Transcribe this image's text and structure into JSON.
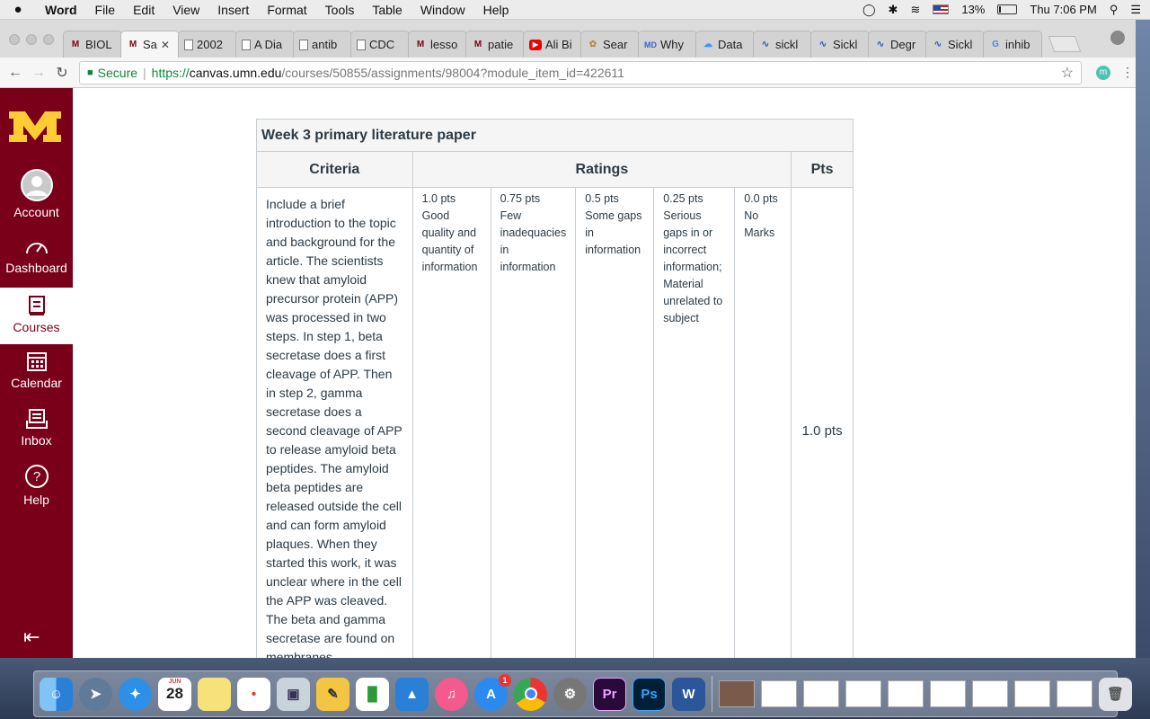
{
  "menubar": {
    "apple": "",
    "app_name": "Word",
    "items": [
      "File",
      "Edit",
      "View",
      "Insert",
      "Format",
      "Tools",
      "Table",
      "Window",
      "Help"
    ],
    "battery_percent": "13%",
    "battery_level": 0.13,
    "clock": "Thu 7:06 PM"
  },
  "tabs": [
    {
      "label": "BIOL",
      "icon": "umn-m-icon"
    },
    {
      "label": "Sa",
      "icon": "umn-m-icon",
      "active": true
    },
    {
      "label": "2002",
      "icon": "document-icon"
    },
    {
      "label": "A Dia",
      "icon": "document-icon"
    },
    {
      "label": "antib",
      "icon": "document-icon"
    },
    {
      "label": "CDC",
      "icon": "document-icon"
    },
    {
      "label": "lesso",
      "icon": "umn-m-icon"
    },
    {
      "label": "patie",
      "icon": "umn-m-icon"
    },
    {
      "label": "Ali Bi",
      "icon": "youtube-icon"
    },
    {
      "label": "Sear",
      "icon": "ali-icon"
    },
    {
      "label": "Why",
      "icon": "webmd-icon"
    },
    {
      "label": "Data",
      "icon": "cloud-icon"
    },
    {
      "label": "sickl",
      "icon": "dna-icon"
    },
    {
      "label": "Sickl",
      "icon": "dna-icon"
    },
    {
      "label": "Degr",
      "icon": "dna-icon"
    },
    {
      "label": "Sickl",
      "icon": "dna-icon"
    },
    {
      "label": "inhib",
      "icon": "google-icon"
    }
  ],
  "address_bar": {
    "secure_label": "Secure",
    "url_scheme": "https://",
    "url_host": "canvas.umn.edu",
    "url_path": "/courses/50855/assignments/98004?module_item_id=422611",
    "extension_letter": "m"
  },
  "sidebar": {
    "items": [
      {
        "label": "Account"
      },
      {
        "label": "Dashboard"
      },
      {
        "label": "Courses",
        "active": true
      },
      {
        "label": "Calendar"
      },
      {
        "label": "Inbox"
      },
      {
        "label": "Help"
      }
    ]
  },
  "rubric": {
    "title": "Week 3 primary literature paper",
    "headers": {
      "criteria": "Criteria",
      "ratings": "Ratings",
      "pts": "Pts"
    },
    "criterion_text": "Include a brief introduction to the topic and background for the article. The scientists knew that amyloid precursor protein (APP) was processed in two steps. In step 1, beta secretase does a first cleavage of APP. Then in step 2, gamma secretase does a second cleavage of APP to release amyloid beta peptides. The amyloid beta peptides are released outside the cell and can form amyloid plaques. When they started this work, it was unclear where in the cell the APP was cleaved. The beta and gamma secretase are found on membranes",
    "ratings": [
      {
        "pts": "1.0 pts",
        "desc": "Good quality and quantity of information"
      },
      {
        "pts": "0.75 pts",
        "desc": "Few inadequacies in information"
      },
      {
        "pts": "0.5 pts",
        "desc": "Some gaps in information"
      },
      {
        "pts": "0.25 pts",
        "desc": "Serious gaps in or incorrect information; Material unrelated to subject"
      },
      {
        "pts": "0.0 pts",
        "desc": "No Marks"
      }
    ],
    "points": "1.0 pts"
  },
  "dock": {
    "calendar_month": "JUN",
    "calendar_day": "28",
    "appstore_badge": "1",
    "premiere_label": "Pr",
    "photoshop_label": "Ps",
    "word_label": "W"
  }
}
